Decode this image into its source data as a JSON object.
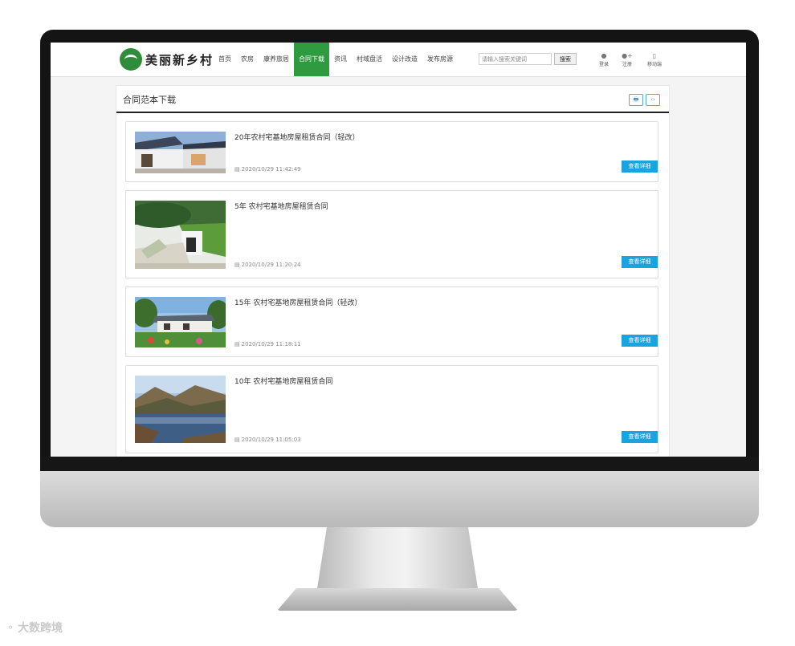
{
  "site": {
    "logo_text": "美丽新乡村",
    "nav": [
      "首页",
      "农房",
      "康养旅居",
      "合同下载",
      "资讯",
      "村域盘活",
      "设计改造",
      "发布房源"
    ],
    "active_nav_index": 3,
    "search_placeholder": "请输入搜索关键词",
    "search_button": "搜索",
    "header_links": [
      {
        "label": "登录",
        "icon": "user-icon"
      },
      {
        "label": "注册",
        "icon": "user-add-icon"
      },
      {
        "label": "移动端",
        "icon": "mobile-icon"
      }
    ],
    "accent_color": "#2e9b41",
    "button_color": "#1aa3dc"
  },
  "panel": {
    "title": "合同范本下载",
    "tools": [
      {
        "icon": "print-icon",
        "glyph": "🖶"
      },
      {
        "icon": "code-icon",
        "glyph": "‹›"
      }
    ]
  },
  "contracts": [
    {
      "title": "20年农村宅基地房屋租赁合同（轻改）",
      "date": "2020/10/29 11:42:49",
      "button": "查看详细",
      "thumb": "modern-house"
    },
    {
      "title": "5年 农村宅基地房屋租赁合同",
      "date": "2020/10/29 11:20:24",
      "button": "查看详细",
      "thumb": "hillside-house"
    },
    {
      "title": "15年 农村宅基地房屋租赁合同（轻改）",
      "date": "2020/10/29 11:18:11",
      "button": "查看详细",
      "thumb": "garden-house"
    },
    {
      "title": "10年 农村宅基地房屋租赁合同",
      "date": "2020/10/29 11:05:03",
      "button": "查看详细",
      "thumb": "lake-valley"
    }
  ],
  "watermark": "大数跨境"
}
